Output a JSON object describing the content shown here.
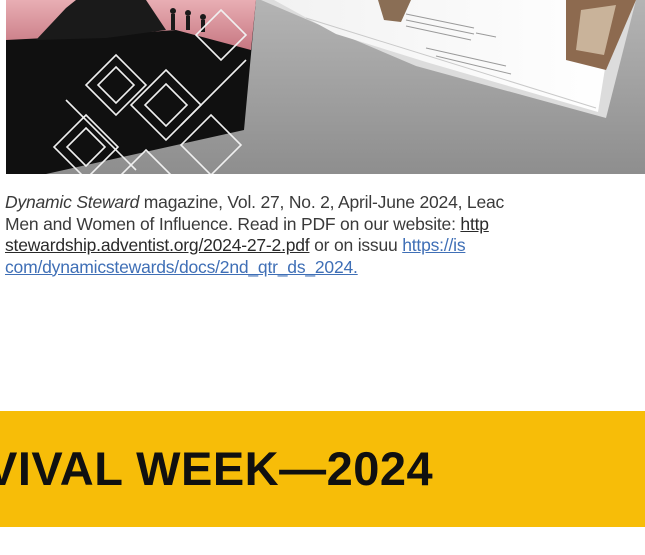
{
  "caption": {
    "title_italic": "Dynamic Steward",
    "line1_rest": " magazine, Vol. 27, No. 2, April-June 2024, Leac",
    "line2_text": "Men and Women of Influence. Read in PDF on our website: ",
    "link1_part1": "http",
    "link1_part2": "stewardship.adventist.org/2024-27-2.pdf",
    "middle_text": " or on issuu ",
    "link2_part1": "https://is",
    "link2_part2": "com/dynamicstewards/docs/2nd_qtr_ds_2024. "
  },
  "banner": {
    "title": "VIVAL WEEK—2024"
  },
  "colors": {
    "banner_bg": "#f7bd08",
    "link": "#3f6fb6",
    "text": "#3a3a3a"
  }
}
